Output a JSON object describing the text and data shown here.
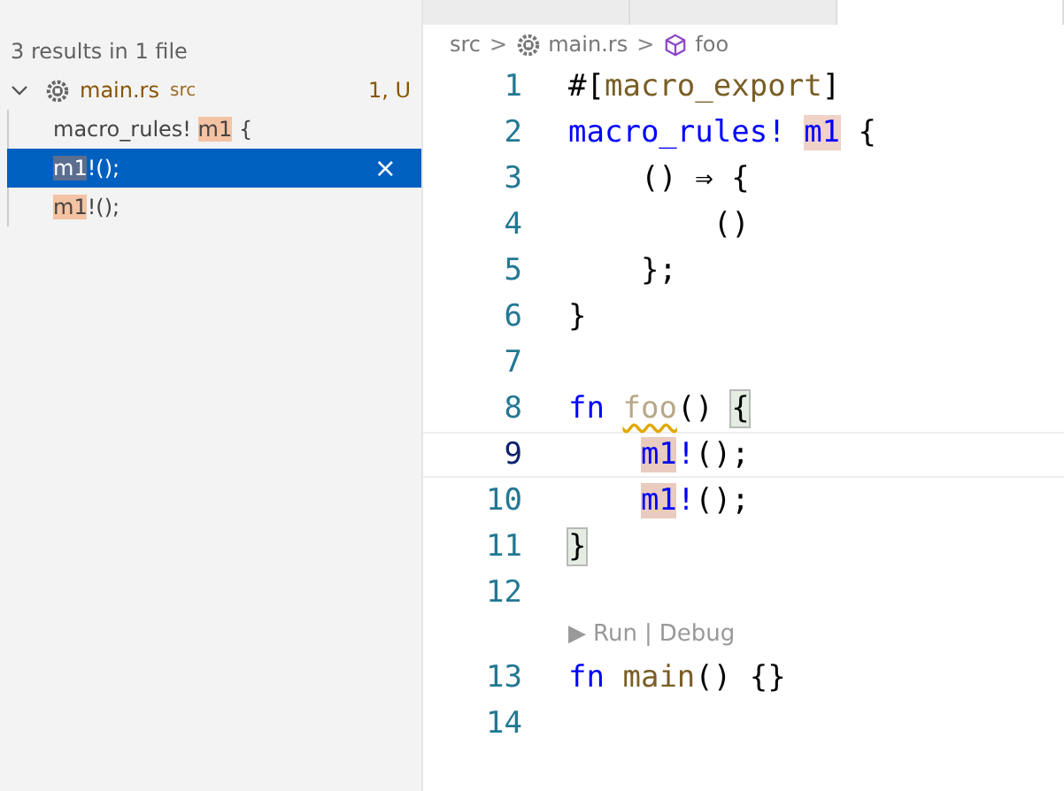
{
  "search": {
    "summary": "3 results in 1 file",
    "files": [
      {
        "name": "main.rs",
        "folder": "src",
        "badge": "1, U",
        "expanded": true,
        "results": [
          {
            "before": "macro_rules! ",
            "match": "m1",
            "after": " {",
            "selected": false
          },
          {
            "match": "m1",
            "after": "!();",
            "selected": true,
            "action": "×"
          },
          {
            "match": "m1",
            "after": "!();",
            "selected": false
          }
        ]
      }
    ]
  },
  "editor": {
    "breadcrumb": [
      {
        "kind": "folder",
        "label": "src"
      },
      {
        "kind": "file",
        "label": "main.rs"
      },
      {
        "kind": "symbol",
        "label": "foo"
      }
    ],
    "separator": ">",
    "lines": [
      {
        "number": "1",
        "current": false,
        "indented": false,
        "tokens": [
          {
            "kind": "plain",
            "t": "#["
          },
          {
            "kind": "fn",
            "t": "macro_export"
          },
          {
            "kind": "plain",
            "t": "]"
          }
        ]
      },
      {
        "number": "2",
        "current": false,
        "indented": false,
        "tokens": [
          {
            "kind": "kw",
            "t": "macro_rules! "
          },
          {
            "kind": "ref",
            "t": "m1"
          },
          {
            "kind": "plain",
            "t": " {"
          }
        ]
      },
      {
        "number": "3",
        "current": false,
        "indented": true,
        "tokens": [
          {
            "kind": "plain",
            "t": "() ⇒ {"
          }
        ]
      },
      {
        "number": "4",
        "current": false,
        "indented": true,
        "tokens": [
          {
            "kind": "plain",
            "t": "    ()"
          }
        ]
      },
      {
        "number": "5",
        "current": false,
        "indented": true,
        "tokens": [
          {
            "kind": "plain",
            "t": "};"
          }
        ]
      },
      {
        "number": "6",
        "current": false,
        "indented": false,
        "tokens": [
          {
            "kind": "plain",
            "t": "}"
          }
        ]
      },
      {
        "number": "7",
        "current": false,
        "indented": false
      },
      {
        "number": "8",
        "current": false,
        "indented": false,
        "tokens": [
          {
            "kind": "kw",
            "t": "fn "
          },
          {
            "kind": "unused",
            "t": "foo"
          },
          {
            "kind": "plain",
            "t": "() "
          },
          {
            "kind": "bracket",
            "t": "{"
          }
        ]
      },
      {
        "number": "9",
        "current": true,
        "indented": true,
        "tokens": [
          {
            "kind": "refcall",
            "t": "m1"
          },
          {
            "kind": "kw",
            "t": "!"
          },
          {
            "kind": "plain",
            "t": "();"
          }
        ]
      },
      {
        "number": "10",
        "current": false,
        "indented": true,
        "tokens": [
          {
            "kind": "refcall",
            "t": "m1"
          },
          {
            "kind": "kw",
            "t": "!"
          },
          {
            "kind": "plain",
            "t": "();"
          }
        ]
      },
      {
        "number": "11",
        "current": false,
        "indented": false,
        "tokens": [
          {
            "kind": "bracket",
            "t": "}"
          }
        ]
      },
      {
        "number": "12",
        "current": false,
        "indented": false,
        "codelens": {
          "icon": "▶",
          "links": [
            "Run",
            "Debug"
          ],
          "sep": "|"
        }
      },
      {
        "number": "13",
        "current": false,
        "indented": false,
        "tokens": [
          {
            "kind": "kw",
            "t": "fn "
          },
          {
            "kind": "fn",
            "t": "main"
          },
          {
            "kind": "plain",
            "t": "() {}"
          }
        ]
      },
      {
        "number": "14",
        "current": false,
        "indented": false
      }
    ]
  }
}
